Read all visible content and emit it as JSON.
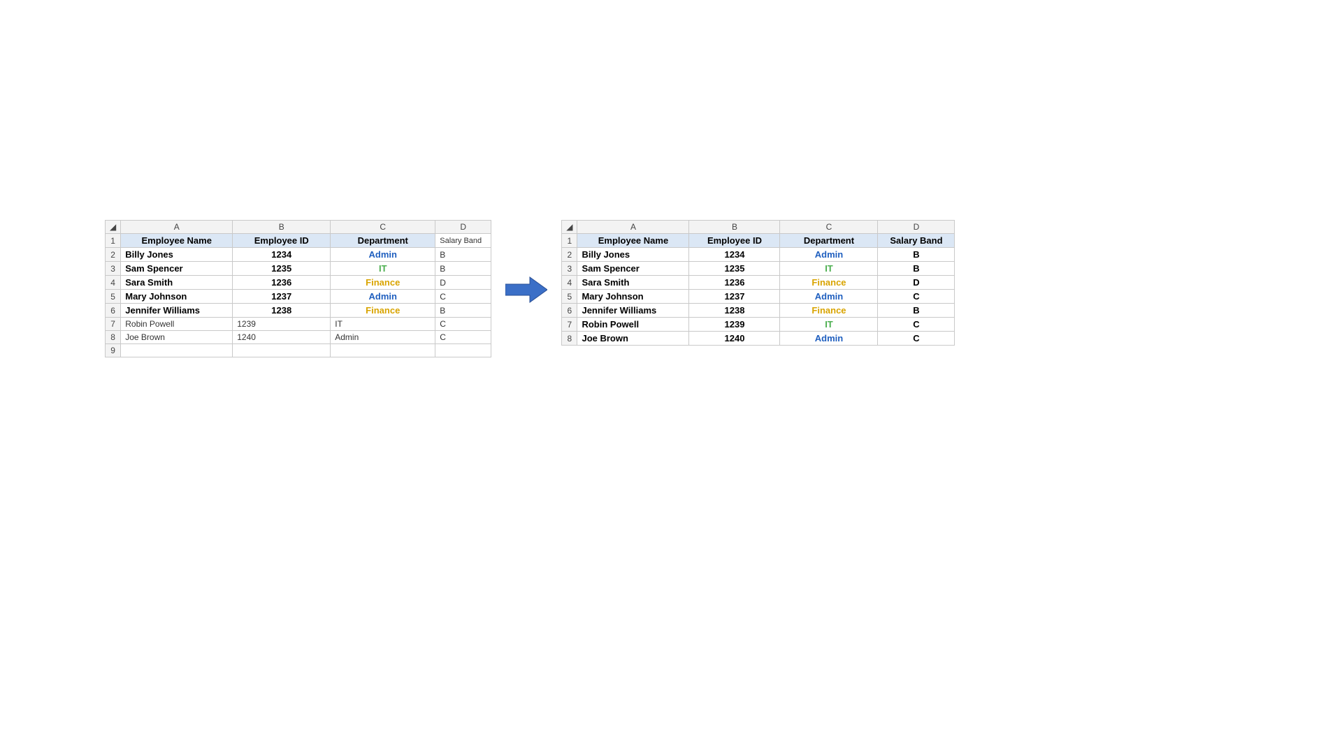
{
  "columns": [
    "A",
    "B",
    "C",
    "D"
  ],
  "headers": {
    "employee_name": "Employee Name",
    "employee_id": "Employee ID",
    "department": "Department",
    "salary_band": "Salary Band"
  },
  "dept_style": {
    "Admin": "dep-admin",
    "IT": "dep-it",
    "Finance": "dep-finance"
  },
  "table_left": {
    "unformatted_header_salary": true,
    "rows": [
      {
        "n": "2",
        "name": "Billy Jones",
        "id": "1234",
        "dept": "Admin",
        "band": "B",
        "formatted": true
      },
      {
        "n": "3",
        "name": "Sam Spencer",
        "id": "1235",
        "dept": "IT",
        "band": "B",
        "formatted": true
      },
      {
        "n": "4",
        "name": "Sara Smith",
        "id": "1236",
        "dept": "Finance",
        "band": "D",
        "formatted": true
      },
      {
        "n": "5",
        "name": "Mary Johnson",
        "id": "1237",
        "dept": "Admin",
        "band": "C",
        "formatted": true
      },
      {
        "n": "6",
        "name": "Jennifer  Williams",
        "id": "1238",
        "dept": "Finance",
        "band": "B",
        "formatted": true
      },
      {
        "n": "7",
        "name": "Robin Powell",
        "id": "1239",
        "dept": "IT",
        "band": "C",
        "formatted": false
      },
      {
        "n": "8",
        "name": "Joe Brown",
        "id": "1240",
        "dept": "Admin",
        "band": "C",
        "formatted": false
      }
    ],
    "extra_row": "9"
  },
  "table_right": {
    "rows": [
      {
        "n": "2",
        "name": "Billy Jones",
        "id": "1234",
        "dept": "Admin",
        "band": "B"
      },
      {
        "n": "3",
        "name": "Sam Spencer",
        "id": "1235",
        "dept": "IT",
        "band": "B"
      },
      {
        "n": "4",
        "name": "Sara Smith",
        "id": "1236",
        "dept": "Finance",
        "band": "D"
      },
      {
        "n": "5",
        "name": "Mary Johnson",
        "id": "1237",
        "dept": "Admin",
        "band": "C"
      },
      {
        "n": "6",
        "name": "Jennifer  Williams",
        "id": "1238",
        "dept": "Finance",
        "band": "B"
      },
      {
        "n": "7",
        "name": "Robin Powell",
        "id": "1239",
        "dept": "IT",
        "band": "C"
      },
      {
        "n": "8",
        "name": "Joe Brown",
        "id": "1240",
        "dept": "Admin",
        "band": "C"
      }
    ]
  }
}
